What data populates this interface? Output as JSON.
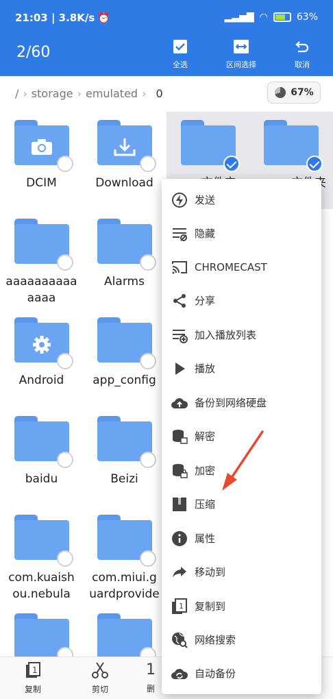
{
  "status": {
    "time_speed": "21:03 | 3.8K/s",
    "battery": "63%"
  },
  "toolbar": {
    "selection_count": "2/60",
    "select_all": "全选",
    "range_select": "区间选择",
    "cancel": "取消"
  },
  "breadcrumb": {
    "root": "/",
    "items": [
      "storage",
      "emulated",
      "0"
    ],
    "storage_percent": "67%"
  },
  "grid": {
    "row1": [
      "DCIM",
      "Download",
      "aaa文件夹",
      "aaaaa文件夹"
    ],
    "row2": [
      "aaaaaaaaaaaaaa",
      "Alarms"
    ],
    "row3": [
      "Android",
      "app_config"
    ],
    "row4": [
      "baidu",
      "Beizi"
    ],
    "row5": [
      "com.kuaishou.nebula",
      "com.miui.guardprovide"
    ],
    "row2_name": "aaaaaaaaaa\naaaa",
    "row5a": "com.kuaish\nou.nebula",
    "row5b": "com.miui.g\nuardprovide"
  },
  "bottom": {
    "copy": "复制",
    "cut": "剪切",
    "partial": "删"
  },
  "menu": {
    "items": [
      "发送",
      "隐藏",
      "CHROMECAST",
      "分享",
      "加入播放列表",
      "播放",
      "备份到网络硬盘",
      "解密",
      "加密",
      "压缩",
      "属性",
      "移动到",
      "复制到",
      "网络搜索",
      "自动备份"
    ]
  },
  "colors": {
    "accent": "#2f7be6",
    "folder": "#6ba5f1",
    "arrow": "#e64a2e"
  }
}
